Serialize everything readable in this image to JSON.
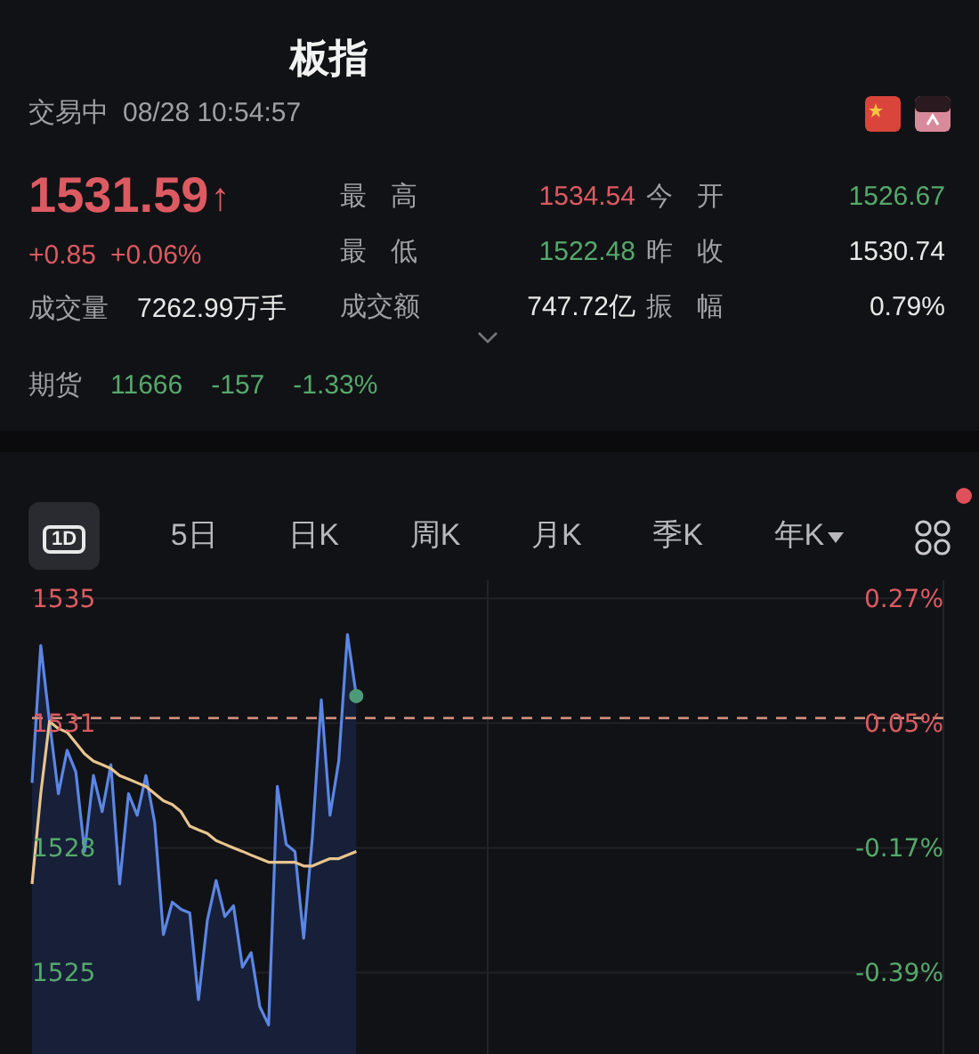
{
  "header": {
    "title": "板指",
    "status": "交易中",
    "datetime": "08/28 10:54:57",
    "flags": [
      {
        "kind": "china"
      },
      {
        "kind": "other"
      }
    ]
  },
  "quote": {
    "price": "1531.59",
    "arrow": "↑",
    "change": "+0.85",
    "change_pct": "+0.06%",
    "color": "#dc5a62"
  },
  "volume": {
    "label": "成交量",
    "value": "7262.99万手"
  },
  "stats": [
    {
      "label": "最高",
      "value": "1534.54",
      "color": "#dc5a62"
    },
    {
      "label": "今开",
      "value": "1526.67",
      "color": "#55a86c"
    },
    {
      "label": "最低",
      "value": "1522.48",
      "color": "#55a86c"
    },
    {
      "label": "昨收",
      "value": "1530.74",
      "color": "#e8e8e8"
    },
    {
      "label": "成交额",
      "value": "747.72亿",
      "color": "#e8e8e8"
    },
    {
      "label": "振幅",
      "value": "0.79%",
      "color": "#e8e8e8"
    }
  ],
  "futures": {
    "label": "期货",
    "price": "11666",
    "change": "-157",
    "change_pct": "-1.33%",
    "color": "#55a86c"
  },
  "tabs": [
    {
      "label": "1D",
      "kind": "boxed",
      "selected": true
    },
    {
      "label": "5日",
      "kind": "text",
      "selected": false
    },
    {
      "label": "日K",
      "kind": "text",
      "selected": false
    },
    {
      "label": "周K",
      "kind": "text",
      "selected": false
    },
    {
      "label": "月K",
      "kind": "text",
      "selected": false
    },
    {
      "label": "季K",
      "kind": "text",
      "selected": false
    },
    {
      "label": "年K",
      "kind": "dropdown",
      "selected": false
    }
  ],
  "layout_button": {
    "notification": true
  },
  "chart": {
    "right_labels": [
      {
        "text": "0.27%",
        "color": "#dc5a62"
      },
      {
        "text": "0.05%",
        "color": "#dc5a62"
      },
      {
        "text": "-0.17%",
        "color": "#55a86c"
      },
      {
        "text": "-0.39%",
        "color": "#55a86c"
      }
    ],
    "chart_data": {
      "type": "line",
      "categories": [
        null,
        null,
        null,
        null,
        null,
        null,
        null,
        null,
        null,
        null,
        null,
        null,
        null,
        null,
        null,
        null,
        null,
        null,
        null,
        null,
        null,
        null,
        null,
        null,
        null,
        null,
        null,
        null,
        null,
        null,
        null,
        null,
        null,
        null,
        null,
        null,
        null,
        null,
        null,
        null,
        null,
        null,
        null,
        null,
        null,
        null,
        null,
        null,
        null,
        null,
        null,
        null,
        null,
        null,
        null,
        null,
        null,
        null,
        null,
        null,
        null,
        null,
        null,
        null,
        null,
        null,
        null,
        null,
        null,
        null,
        null,
        null,
        null,
        null,
        null,
        null,
        null,
        null,
        null,
        null,
        null,
        null,
        null,
        null,
        null,
        null,
        null,
        null,
        null,
        null,
        null,
        null,
        null,
        null,
        null,
        null,
        null,
        null,
        null,
        null,
        null,
        null,
        null,
        null,
        null
      ],
      "series": [
        {
          "color": "#5b86e5",
          "values": [
            1529.8,
            1533.6,
            1531.5,
            1529.5,
            1530.7,
            1530.1,
            1527.9,
            1530.0,
            1529.0,
            1530.3,
            1527.0,
            1529.5,
            1528.9,
            1530.0,
            1528.7,
            1525.6,
            1526.5,
            1526.3,
            1526.2,
            1523.8,
            1526.0,
            1527.1,
            1526.1,
            1526.4,
            1524.7,
            1525.1,
            1523.6,
            1523.1,
            1529.7,
            1528.1,
            1527.9,
            1525.5,
            1528.3,
            1532.1,
            1528.9,
            1530.4,
            1533.9,
            1532.2,
            null,
            null,
            null,
            null,
            null,
            null,
            null,
            null,
            null,
            null,
            null,
            null,
            null,
            null,
            null,
            null,
            null,
            null,
            null,
            null,
            null,
            null,
            null,
            null,
            null,
            null,
            null,
            null,
            null,
            null,
            null,
            null,
            null,
            null,
            null,
            null,
            null,
            null,
            null,
            null,
            null,
            null,
            null,
            null,
            null,
            null,
            null,
            null,
            null,
            null,
            null,
            null,
            null,
            null,
            null,
            null,
            null,
            null,
            null,
            null,
            null,
            null,
            null,
            null,
            null,
            null,
            null
          ]
        },
        {
          "color": "#e8c48e",
          "values": [
            1527.0,
            1529.5,
            1531.5,
            1531.3,
            1531.2,
            1530.9,
            1530.6,
            1530.4,
            1530.3,
            1530.2,
            1530.0,
            1529.9,
            1529.8,
            1529.7,
            1529.5,
            1529.3,
            1529.2,
            1529.0,
            1528.6,
            1528.5,
            1528.4,
            1528.2,
            1528.1,
            1528.0,
            1527.9,
            1527.8,
            1527.7,
            1527.6,
            1527.6,
            1527.6,
            1527.6,
            1527.5,
            1527.5,
            1527.6,
            1527.7,
            1527.7,
            1527.8,
            1527.9,
            null,
            null,
            null,
            null,
            null,
            null,
            null,
            null,
            null,
            null,
            null,
            null,
            null,
            null,
            null,
            null,
            null,
            null,
            null,
            null,
            null,
            null,
            null,
            null,
            null,
            null,
            null,
            null,
            null,
            null,
            null,
            null,
            null,
            null,
            null,
            null,
            null,
            null,
            null,
            null,
            null,
            null,
            null,
            null,
            null,
            null,
            null,
            null,
            null,
            null,
            null,
            null,
            null,
            null,
            null,
            null,
            null,
            null,
            null,
            null,
            null,
            null,
            null,
            null,
            null,
            null,
            null
          ]
        }
      ],
      "ylim": [
        1522.0,
        1535.4
      ],
      "yticks": [
        {
          "value": 1534.9,
          "label": "1535"
        },
        {
          "value": 1531.45,
          "label": "1531"
        },
        {
          "value": 1528.0,
          "label": "1528"
        },
        {
          "value": 1524.55,
          "label": "1525"
        }
      ],
      "grid": true,
      "ref_lines": [
        {
          "axis": "y",
          "value": 1531.59
        }
      ]
    }
  }
}
